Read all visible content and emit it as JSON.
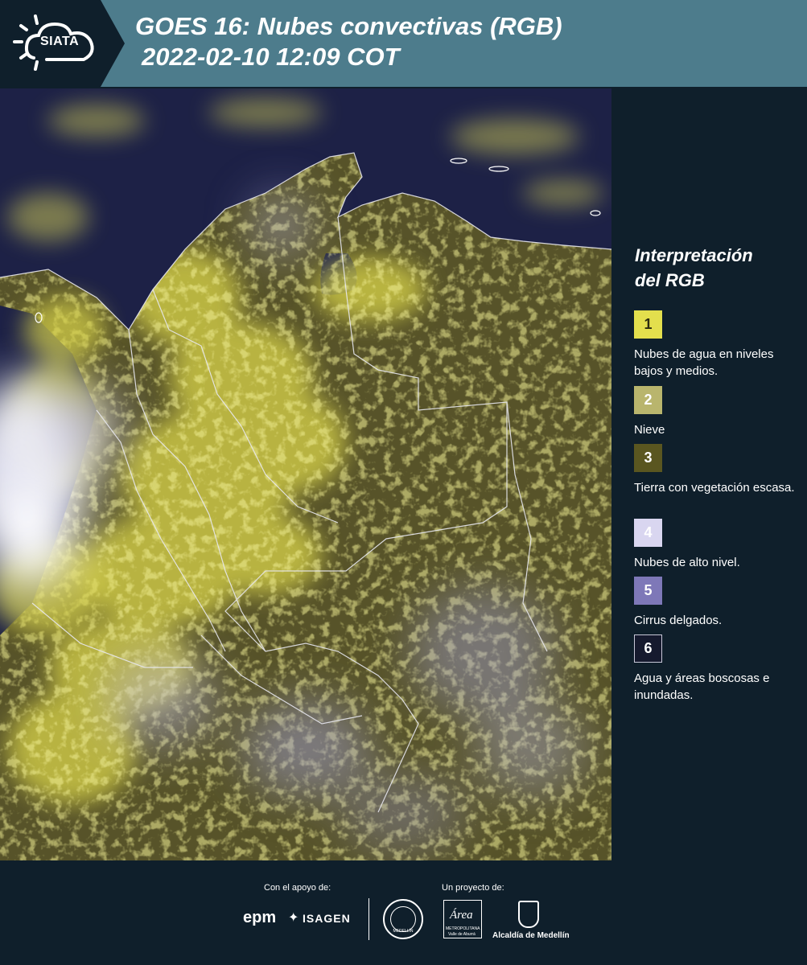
{
  "header": {
    "logo_text": "SIATA",
    "title_line1": "GOES 16: Nubes convectivas (RGB)",
    "title_line2": "2022-02-10 12:09 COT"
  },
  "legend": {
    "title_line1": "Interpretación",
    "title_line2": "del RGB",
    "items": [
      {
        "number": "1",
        "label": "Nubes de agua en niveles bajos y medios.",
        "color": "#e3df4d",
        "text_color": "#2a2a10"
      },
      {
        "number": "2",
        "label": "Nieve",
        "color": "#b9b56d",
        "text_color": "#ffffff"
      },
      {
        "number": "3",
        "label": "Tierra con vegetación escasa.",
        "color": "#5a5620",
        "text_color": "#ffffff"
      },
      {
        "number": "4",
        "label": "Nubes de alto nivel.",
        "color": "#d9d6f0",
        "text_color": "#ffffff"
      },
      {
        "number": "5",
        "label": "Cirrus delgados.",
        "color": "#7e78b8",
        "text_color": "#ffffff"
      },
      {
        "number": "6",
        "label": "Agua y áreas boscosas e inundadas.",
        "color": "#161a2e",
        "text_color": "#ffffff"
      }
    ]
  },
  "footer": {
    "support_caption": "Con el apoyo de:",
    "project_caption": "Un proyecto de:",
    "epm": "epm",
    "isagen": "ISAGEN",
    "area_metro": "Área",
    "area_metro_sub1": "METROPOLITANA",
    "area_metro_sub2": "Valle de Aburrá",
    "alcaldia": "Alcaldía de Medellín",
    "seal_text": "MEDELLÍN"
  },
  "colors": {
    "header_bg": "#4d7c8c",
    "panel_bg": "#0f1f2b",
    "ocean": "#1d2146",
    "land": "#575329",
    "clouds_low": "#e3df4d",
    "clouds_high": "#d9d6f0"
  }
}
